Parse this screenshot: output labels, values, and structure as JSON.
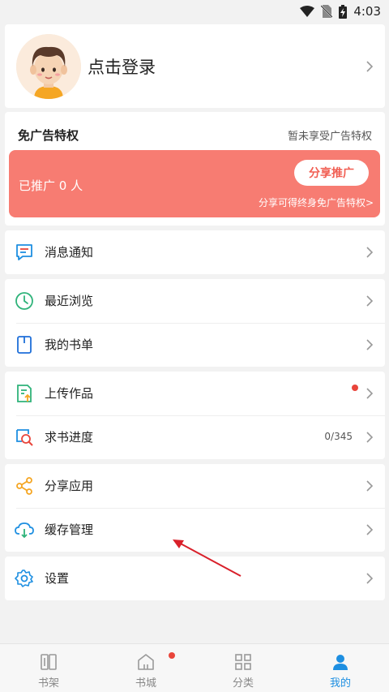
{
  "status_bar": {
    "time": "4:03"
  },
  "profile": {
    "login_label": "点击登录"
  },
  "ad_privilege": {
    "title": "免广告特权",
    "status": "暂未享受广告特权",
    "promoted_count": "已推广 0 人",
    "share_button": "分享推广",
    "share_hint": "分享可得终身免广告特权>"
  },
  "menu": {
    "messages": "消息通知",
    "recent": "最近浏览",
    "booklist": "我的书单",
    "upload": "上传作品",
    "request_progress": "求书进度",
    "request_progress_value": "0/345",
    "share_app": "分享应用",
    "cache": "缓存管理",
    "settings": "设置"
  },
  "tabs": [
    {
      "label": "书架",
      "icon": "bookshelf-icon"
    },
    {
      "label": "书城",
      "icon": "home-icon"
    },
    {
      "label": "分类",
      "icon": "category-grid-icon"
    },
    {
      "label": "我的",
      "icon": "user-icon"
    }
  ],
  "colors": {
    "promo_bg": "#f77c72",
    "accent_blue": "#1e8fe1",
    "badge_red": "#e9453b",
    "annotation_arrow": "#d9202a"
  }
}
